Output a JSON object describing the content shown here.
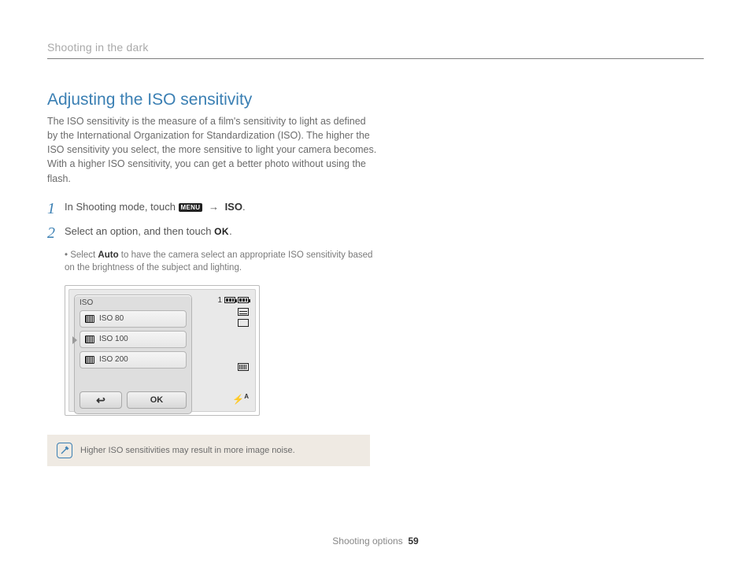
{
  "breadcrumb": "Shooting in the dark",
  "heading": "Adjusting the ISO sensitivity",
  "lead": "The ISO sensitivity is the measure of a film's sensitivity to light as defined by the International Organization for Standardization (ISO). The higher the ISO sensitivity you select, the more sensitive to light your camera becomes. With a higher ISO sensitivity, you can get a better photo without using the flash.",
  "steps": {
    "s1_num": "1",
    "s1_a": "In Shooting mode, touch ",
    "s1_menu": "MENU",
    "s1_arrow": "→",
    "s1_iso": "ISO",
    "s1_end": ".",
    "s2_num": "2",
    "s2_a": "Select an option, and then touch ",
    "s2_ok": "OK",
    "s2_end": ".",
    "sub_prefix": "Select ",
    "sub_bold": "Auto",
    "sub_rest": " to have the camera select an appropriate ISO sensitivity based on the brightness of the subject and lighting."
  },
  "camera": {
    "title": "ISO",
    "rows": [
      "ISO 80",
      "ISO 100",
      "ISO 200"
    ],
    "ok": "OK",
    "count": "1"
  },
  "note": "Higher ISO sensitivities may result in more image noise.",
  "footer_section": "Shooting options",
  "footer_page": "59"
}
